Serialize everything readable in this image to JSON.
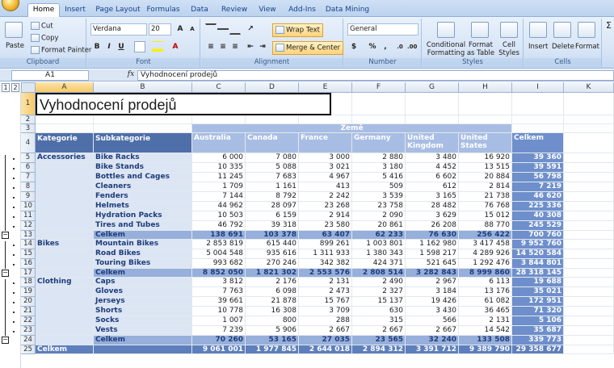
{
  "ribbon": {
    "tabs": [
      "Home",
      "Insert",
      "Page Layout",
      "Formulas",
      "Data",
      "Review",
      "View",
      "Add-Ins",
      "Data Mining"
    ],
    "active_tab": "Home",
    "clipboard": {
      "paste": "Paste",
      "cut": "Cut",
      "copy": "Copy",
      "format_painter": "Format Painter",
      "label": "Clipboard"
    },
    "font": {
      "name": "Verdana",
      "size": "20",
      "bold": "B",
      "italic": "I",
      "underline": "U",
      "label": "Font"
    },
    "alignment": {
      "wrap_text": "Wrap Text",
      "merge_center": "Merge & Center",
      "label": "Alignment"
    },
    "number": {
      "format": "General",
      "currency": "$",
      "percent": "%",
      "comma": ",",
      "label": "Number"
    },
    "styles": {
      "conditional": "Conditional\nFormatting",
      "format_table": "Format\nas Table",
      "cell_styles": "Cell\nStyles",
      "label": "Styles"
    },
    "cells": {
      "insert": "Insert",
      "delete": "Delete",
      "format": "Format",
      "label": "Cells"
    },
    "sigma": "Σ"
  },
  "formula_bar": {
    "name_box": "A1",
    "fx": "fx",
    "content": "Vyhodnocení prodejů"
  },
  "outline_levels": [
    "1",
    "2"
  ],
  "columns": [
    "A",
    "B",
    "C",
    "D",
    "E",
    "F",
    "G",
    "H",
    "I",
    "K"
  ],
  "rows": [
    "1",
    "2",
    "3",
    "4",
    "5",
    "6",
    "7",
    "8",
    "9",
    "10",
    "11",
    "12",
    "13",
    "14",
    "15",
    "16",
    "17",
    "18",
    "19",
    "20",
    "21",
    "22",
    "23",
    "24",
    "25"
  ],
  "sheet": {
    "title": "Vyhodnocení prodejů",
    "country_group": "Země",
    "header_kategorie": "Kategorie",
    "header_subkategorie": "Subkategorie",
    "countries": [
      "Australia",
      "Canada",
      "France",
      "Germany",
      "United Kingdom",
      "United States"
    ],
    "header_total": "Celkem",
    "data_rows": [
      {
        "cat": "Accessories",
        "sub": "Bike Racks",
        "vals": [
          "6 000",
          "7 080",
          "3 000",
          "2 880",
          "3 480",
          "16 920"
        ],
        "total": "39 360"
      },
      {
        "cat": "",
        "sub": "Bike Stands",
        "vals": [
          "10 335",
          "5 088",
          "3 021",
          "3 180",
          "4 452",
          "13 515"
        ],
        "total": "39 591"
      },
      {
        "cat": "",
        "sub": "Bottles and Cages",
        "vals": [
          "11 245",
          "7 683",
          "4 967",
          "5 416",
          "6 602",
          "20 884"
        ],
        "total": "56 798"
      },
      {
        "cat": "",
        "sub": "Cleaners",
        "vals": [
          "1 709",
          "1 161",
          "413",
          "509",
          "612",
          "2 814"
        ],
        "total": "7 219"
      },
      {
        "cat": "",
        "sub": "Fenders",
        "vals": [
          "7 144",
          "8 792",
          "2 242",
          "3 539",
          "3 165",
          "21 738"
        ],
        "total": "46 620"
      },
      {
        "cat": "",
        "sub": "Helmets",
        "vals": [
          "44 962",
          "28 097",
          "23 268",
          "23 758",
          "28 482",
          "76 768"
        ],
        "total": "225 336"
      },
      {
        "cat": "",
        "sub": "Hydration Packs",
        "vals": [
          "10 503",
          "6 159",
          "2 914",
          "2 090",
          "3 629",
          "15 012"
        ],
        "total": "40 308"
      },
      {
        "cat": "",
        "sub": "Tires and Tubes",
        "vals": [
          "46 792",
          "39 318",
          "23 580",
          "20 861",
          "26 208",
          "88 770"
        ],
        "total": "245 529"
      },
      {
        "cat": "",
        "sub": "Celkem",
        "vals": [
          "138 691",
          "103 378",
          "63 407",
          "62 233",
          "76 630",
          "256 422"
        ],
        "total": "700 760",
        "type": "subtotal"
      },
      {
        "cat": "Bikes",
        "sub": "Mountain Bikes",
        "vals": [
          "2 853 819",
          "615 440",
          "899 261",
          "1 003 801",
          "1 162 980",
          "3 417 458"
        ],
        "total": "9 952 760"
      },
      {
        "cat": "",
        "sub": "Road Bikes",
        "vals": [
          "5 004 548",
          "935 616",
          "1 311 933",
          "1 380 343",
          "1 598 217",
          "4 289 926"
        ],
        "total": "14 520 584"
      },
      {
        "cat": "",
        "sub": "Touring Bikes",
        "vals": [
          "993 682",
          "270 246",
          "342 382",
          "424 371",
          "521 645",
          "1 292 476"
        ],
        "total": "3 844 801"
      },
      {
        "cat": "",
        "sub": "Celkem",
        "vals": [
          "8 852 050",
          "1 821 302",
          "2 553 576",
          "2 808 514",
          "3 282 843",
          "8 999 860"
        ],
        "total": "28 318 145",
        "type": "subtotal"
      },
      {
        "cat": "Clothing",
        "sub": "Caps",
        "vals": [
          "3 812",
          "2 176",
          "2 131",
          "2 490",
          "2 967",
          "6 113"
        ],
        "total": "19 688"
      },
      {
        "cat": "",
        "sub": "Gloves",
        "vals": [
          "7 763",
          "6 098",
          "2 473",
          "2 327",
          "3 184",
          "13 176"
        ],
        "total": "35 021"
      },
      {
        "cat": "",
        "sub": "Jerseys",
        "vals": [
          "39 661",
          "21 878",
          "15 767",
          "15 137",
          "19 426",
          "61 082"
        ],
        "total": "172 951"
      },
      {
        "cat": "",
        "sub": "Shorts",
        "vals": [
          "10 778",
          "16 308",
          "3 709",
          "630",
          "3 430",
          "36 465"
        ],
        "total": "71 320"
      },
      {
        "cat": "",
        "sub": "Socks",
        "vals": [
          "1 007",
          "800",
          "288",
          "315",
          "566",
          "2 131"
        ],
        "total": "5 106"
      },
      {
        "cat": "",
        "sub": "Vests",
        "vals": [
          "7 239",
          "5 906",
          "2 667",
          "2 667",
          "2 667",
          "14 542"
        ],
        "total": "35 687"
      },
      {
        "cat": "",
        "sub": "Celkem",
        "vals": [
          "70 260",
          "53 165",
          "27 035",
          "23 565",
          "32 240",
          "133 508"
        ],
        "total": "339 773",
        "type": "subtotal"
      },
      {
        "cat": "Celkem",
        "sub": "",
        "vals": [
          "9 061 001",
          "1 977 845",
          "2 644 018",
          "2 894 312",
          "3 391 712",
          "9 389 790"
        ],
        "total": "29 358 677",
        "type": "grand"
      }
    ]
  }
}
